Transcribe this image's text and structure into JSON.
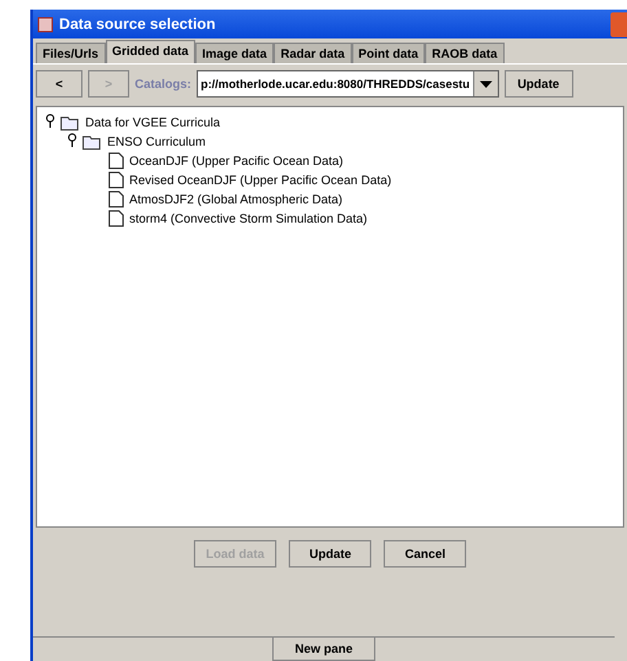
{
  "window": {
    "title": "Data source selection"
  },
  "tabs": [
    {
      "label": "Files/Urls",
      "selected": false
    },
    {
      "label": "Gridded data",
      "selected": true
    },
    {
      "label": "Image data",
      "selected": false
    },
    {
      "label": "Radar data",
      "selected": false
    },
    {
      "label": "Point data",
      "selected": false
    },
    {
      "label": "RAOB  data",
      "selected": false
    }
  ],
  "toolbar": {
    "back": {
      "label": "<",
      "disabled": false
    },
    "forward": {
      "label": ">",
      "disabled": true
    },
    "catalogs_label": "Catalogs:",
    "catalog_value": "p://motherlode.ucar.edu:8080/THREDDS/casestu",
    "update": "Update"
  },
  "tree": [
    {
      "label": "Data for VGEE Curricula",
      "kind": "folder",
      "expanded": true,
      "children": [
        {
          "label": "ENSO Curriculum",
          "kind": "folder",
          "expanded": true,
          "children": [
            {
              "label": "OceanDJF (Upper Pacific Ocean Data)",
              "kind": "file"
            },
            {
              "label": "Revised OceanDJF (Upper Pacific Ocean Data)",
              "kind": "file"
            },
            {
              "label": "AtmosDJF2 (Global Atmospheric Data)",
              "kind": "file"
            },
            {
              "label": "storm4 (Convective Storm Simulation Data)",
              "kind": "file"
            }
          ]
        }
      ]
    }
  ],
  "buttons": [
    {
      "label": "Load data",
      "disabled": true
    },
    {
      "label": "Update",
      "disabled": false
    },
    {
      "label": "Cancel",
      "disabled": false
    }
  ],
  "bottom_tab": "New pane"
}
